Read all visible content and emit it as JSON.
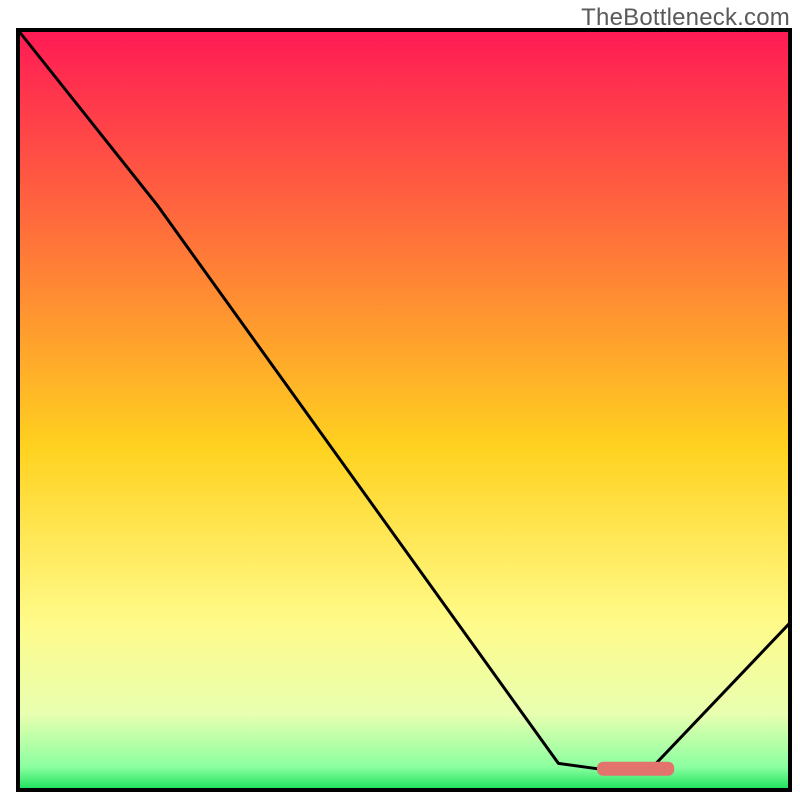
{
  "watermark": "TheBottleneck.com",
  "chart_data": {
    "type": "line",
    "title": "",
    "xlabel": "",
    "ylabel": "",
    "xlim": [
      0,
      100
    ],
    "ylim": [
      0,
      100
    ],
    "grid": false,
    "legend": false,
    "series": [
      {
        "name": "curve",
        "x": [
          0,
          18,
          70,
          75,
          82,
          100
        ],
        "y": [
          100,
          77,
          3.5,
          2.8,
          2.8,
          22
        ]
      }
    ],
    "plateau_marker": {
      "x_start": 75,
      "x_end": 85,
      "y": 2.8,
      "color": "#e2736d"
    },
    "gradient_stops": [
      {
        "offset": 0,
        "color": "#ff1a55"
      },
      {
        "offset": 25,
        "color": "#ff6a3c"
      },
      {
        "offset": 55,
        "color": "#ffd21f"
      },
      {
        "offset": 78,
        "color": "#fffb8a"
      },
      {
        "offset": 90,
        "color": "#e8ffb0"
      },
      {
        "offset": 97,
        "color": "#8bffa0"
      },
      {
        "offset": 100,
        "color": "#18e05a"
      }
    ]
  }
}
